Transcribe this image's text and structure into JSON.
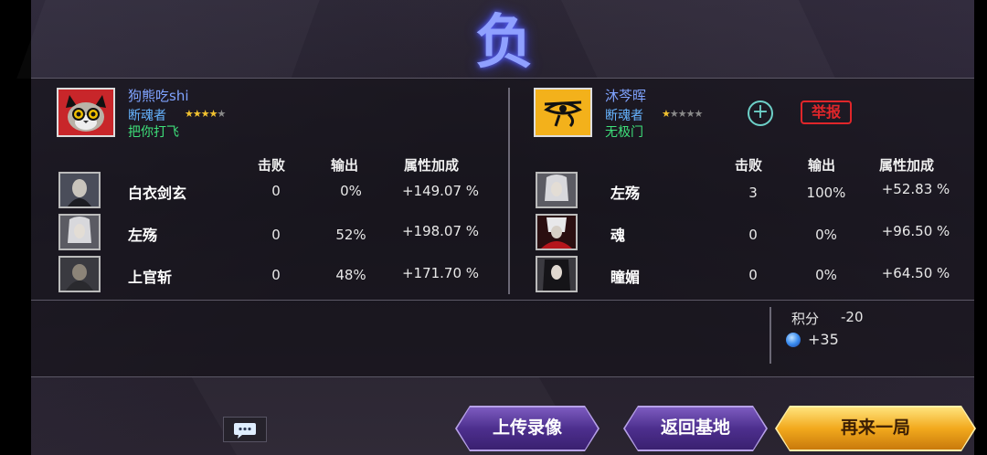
{
  "result_title": "负",
  "left_player": {
    "name": "狗熊吃shi",
    "role": "断魂者",
    "stars": 4,
    "guild": "把你打飞"
  },
  "right_player": {
    "name": "沐芩晖",
    "role": "断魂者",
    "stars": 1,
    "guild": "无极门",
    "add_label": "+",
    "report_label": "举报"
  },
  "headers": {
    "kills": "击败",
    "output": "输出",
    "bonus": "属性加成"
  },
  "left_team": [
    {
      "name": "白衣剑玄",
      "kills": "0",
      "output": "0%",
      "bonus": "+149.07 %"
    },
    {
      "name": "左殇",
      "kills": "0",
      "output": "52%",
      "bonus": "+198.07 %"
    },
    {
      "name": "上官斩",
      "kills": "0",
      "output": "48%",
      "bonus": "+171.70 %"
    }
  ],
  "right_team": [
    {
      "name": "左殇",
      "kills": "3",
      "output": "100%",
      "bonus": "+52.83 %"
    },
    {
      "name": "魂",
      "kills": "0",
      "output": "0%",
      "bonus": "+96.50 %"
    },
    {
      "name": "瞳媚",
      "kills": "0",
      "output": "0%",
      "bonus": "+64.50 %"
    }
  ],
  "score": {
    "label": "积分",
    "value": "-20",
    "gem_value": "+35"
  },
  "buttons": {
    "upload": "上传录像",
    "back": "返回基地",
    "again": "再来一局"
  },
  "chat_icon": "chat-bubble-icon",
  "colors": {
    "name": "#7fa3ff",
    "role": "#66b4ff",
    "guild": "#3ee07a",
    "report": "#e0262a",
    "title_glow": "#5a64ff"
  }
}
